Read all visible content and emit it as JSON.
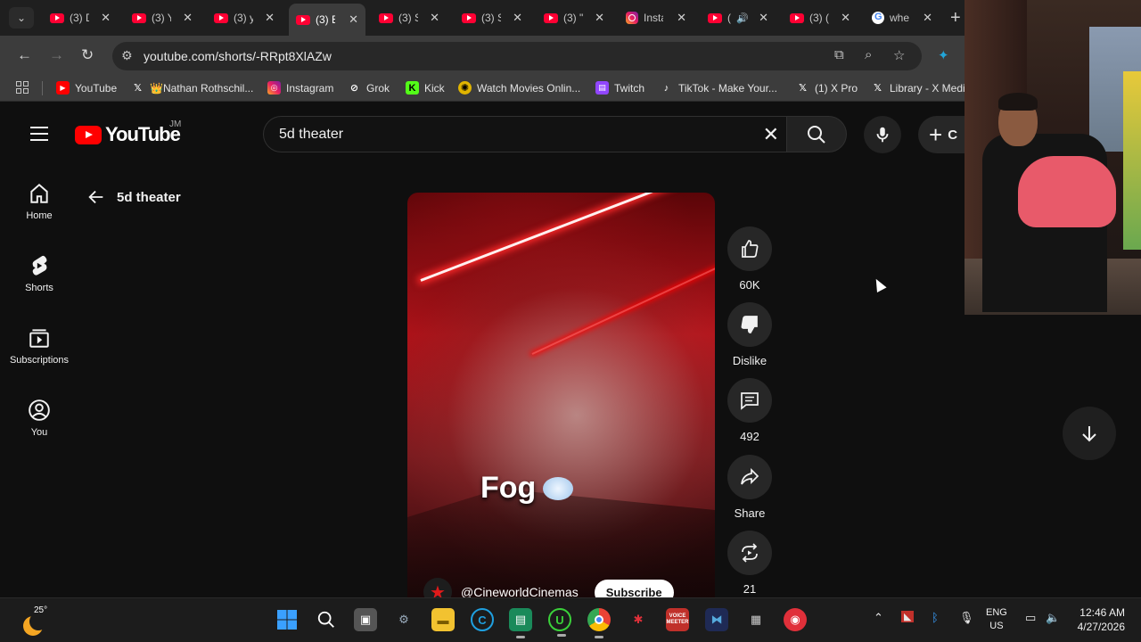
{
  "tabs": [
    {
      "title": "(3) D",
      "icon": "youtube-icon"
    },
    {
      "title": "(3) Y",
      "icon": "youtube-icon"
    },
    {
      "title": "(3) y",
      "icon": "youtube-icon"
    },
    {
      "title": "(3) E",
      "icon": "youtube-icon",
      "active": true
    },
    {
      "title": "(3) S",
      "icon": "youtube-icon"
    },
    {
      "title": "(3) S",
      "icon": "youtube-icon"
    },
    {
      "title": "(3) \"",
      "icon": "youtube-icon"
    },
    {
      "title": "Insta",
      "icon": "instagram-icon"
    },
    {
      "title": "(",
      "icon": "youtube-icon"
    },
    {
      "title": "(3) (",
      "icon": "youtube-icon"
    },
    {
      "title": "whe",
      "icon": "google-icon"
    }
  ],
  "address_bar": {
    "url": "youtube.com/shorts/-RRpt8XlAZw"
  },
  "bookmarks": [
    {
      "label": "YouTube",
      "icon": "youtube-icon"
    },
    {
      "label": "👑Nathan Rothschil...",
      "icon": "x-icon"
    },
    {
      "label": "Instagram",
      "icon": "instagram-icon"
    },
    {
      "label": "Grok",
      "icon": "grok-icon"
    },
    {
      "label": "Kick",
      "icon": "kick-icon"
    },
    {
      "label": "Watch Movies Onlin...",
      "icon": "film-icon"
    },
    {
      "label": "Twitch",
      "icon": "twitch-icon"
    },
    {
      "label": "TikTok - Make Your...",
      "icon": "tiktok-icon"
    },
    {
      "label": "(1) X Pro",
      "icon": "x-icon"
    },
    {
      "label": "Library - X Medi",
      "icon": "x-icon"
    }
  ],
  "youtube": {
    "logo_text": "YouTube",
    "country_code": "JM",
    "search_value": "5d theater",
    "create_label": "C",
    "back_label": "5d theater"
  },
  "sidebar": [
    {
      "label": "Home",
      "icon": "home-icon"
    },
    {
      "label": "Shorts",
      "icon": "shorts-icon"
    },
    {
      "label": "Subscriptions",
      "icon": "subscriptions-icon"
    },
    {
      "label": "You",
      "icon": "account-icon"
    }
  ],
  "short": {
    "caption": "Fog",
    "channel": "@CineworldCinemas",
    "subscribe_label": "Subscribe"
  },
  "actions": {
    "likes": "60K",
    "dislike_label": "Dislike",
    "comments": "492",
    "share_label": "Share",
    "remixes": "21"
  },
  "taskbar": {
    "temperature": "25°",
    "lang_line1": "ENG",
    "lang_line2": "US",
    "time": "12:46 AM",
    "date": "4/27/2026"
  },
  "colors": {
    "youtube_red": "#ff0000",
    "background": "#0f0f0f",
    "chrome_toolbar": "#3c3c3c"
  }
}
